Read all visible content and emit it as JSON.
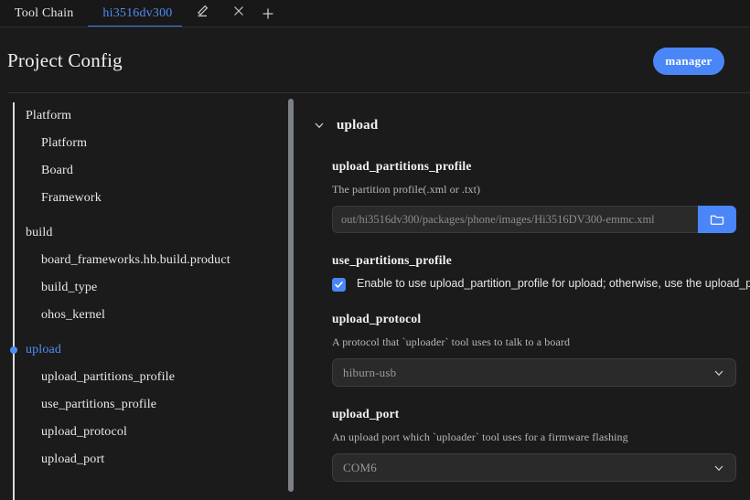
{
  "colors": {
    "accent": "#4a86f7",
    "tab_active_text": "#4f8df5",
    "tab_active_underline": "#3c82ea",
    "window_bg": "#1b1b1b",
    "tabbar_bg": "#181818",
    "field_bg": "#2a2a2a",
    "rail": "#dcdcdc",
    "scrollbar": "#7c7f86"
  },
  "tabbar": {
    "tabs": [
      {
        "label": "Tool Chain",
        "active": false
      },
      {
        "label": "hi3516dv300",
        "active": true
      }
    ],
    "edit_icon": "pencil-icon",
    "close_icon": "close-icon",
    "add_icon": "plus-icon"
  },
  "header": {
    "title": "Project Config",
    "manager_label": "manager"
  },
  "sidebar": {
    "items": [
      {
        "label": "Platform",
        "level": 0,
        "selected": false
      },
      {
        "label": "Platform",
        "level": 1,
        "selected": false
      },
      {
        "label": "Board",
        "level": 1,
        "selected": false
      },
      {
        "label": "Framework",
        "level": 1,
        "selected": false
      },
      {
        "label": "build",
        "level": 0,
        "selected": false
      },
      {
        "label": "board_frameworks.hb.build.product",
        "level": 1,
        "selected": false
      },
      {
        "label": "build_type",
        "level": 1,
        "selected": false
      },
      {
        "label": "ohos_kernel",
        "level": 1,
        "selected": false
      },
      {
        "label": "upload",
        "level": 0,
        "selected": true
      },
      {
        "label": "upload_partitions_profile",
        "level": 1,
        "selected": false
      },
      {
        "label": "use_partitions_profile",
        "level": 1,
        "selected": false
      },
      {
        "label": "upload_protocol",
        "level": 1,
        "selected": false
      },
      {
        "label": "upload_port",
        "level": 1,
        "selected": false
      }
    ]
  },
  "panel": {
    "section_title": "upload",
    "chevron_icon": "chevron-down-icon",
    "fields": {
      "upload_partitions_profile": {
        "label": "upload_partitions_profile",
        "description": "The partition profile(.xml or .txt)",
        "value": "out/hi3516dv300/packages/phone/images/Hi3516DV300-emmc.xml",
        "placeholder": "out/hi3516dv300/packages/phone/images/Hi3516DV300-emmc.xml",
        "browse_icon": "folder-icon"
      },
      "use_partitions_profile": {
        "label": "use_partitions_profile",
        "checkbox_label": "Enable to use upload_partition_profile for upload; otherwise, use the upload_par",
        "checked": true,
        "check_icon": "check-icon"
      },
      "upload_protocol": {
        "label": "upload_protocol",
        "description": "A protocol that `uploader` tool uses to talk to a board",
        "value": "hiburn-usb",
        "chevron_icon": "chevron-down-icon"
      },
      "upload_port": {
        "label": "upload_port",
        "description": "An upload port which `uploader` tool uses for a firmware flashing",
        "value": "COM6",
        "chevron_icon": "chevron-down-icon"
      }
    }
  }
}
